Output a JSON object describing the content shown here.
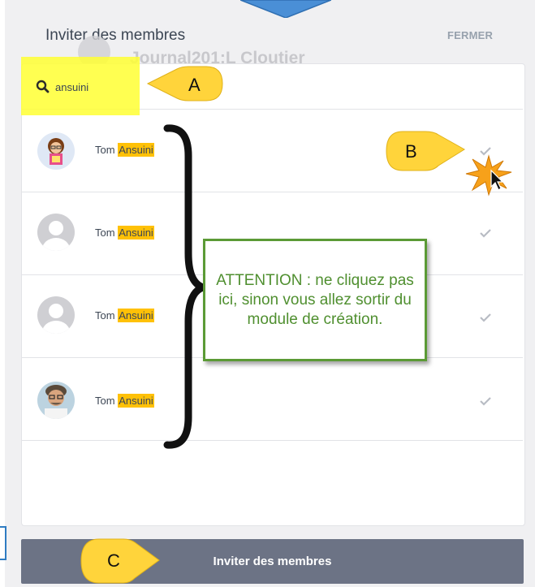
{
  "header": {
    "title": "Inviter des membres",
    "close_label": "FERMER",
    "background_text": "Journal201:L Cloutier"
  },
  "search": {
    "value": "ansuini",
    "icon": "search-icon"
  },
  "results": [
    {
      "first": "Tom",
      "match": "Ansuini",
      "avatar": "cartoon-avatar"
    },
    {
      "first": "Tom",
      "match": "Ansuini",
      "avatar": "default-avatar"
    },
    {
      "first": "Tom",
      "match": "Ansuini",
      "avatar": "default-avatar"
    },
    {
      "first": "Tom",
      "match": "Ansuini",
      "avatar": "photo-avatar"
    }
  ],
  "footer": {
    "invite_button": "Inviter des membres"
  },
  "annotations": {
    "a": "A",
    "b": "B",
    "c": "C",
    "warning": "ATTENTION : ne cliquez pas ici, sinon vous allez sortir du module de création."
  },
  "colors": {
    "highlight": "#ffc107",
    "callout_tag": "#ffd43b",
    "warning_border": "#5b9a35",
    "button_bg": "#6c7385",
    "search_highlight": "#ffff33"
  }
}
